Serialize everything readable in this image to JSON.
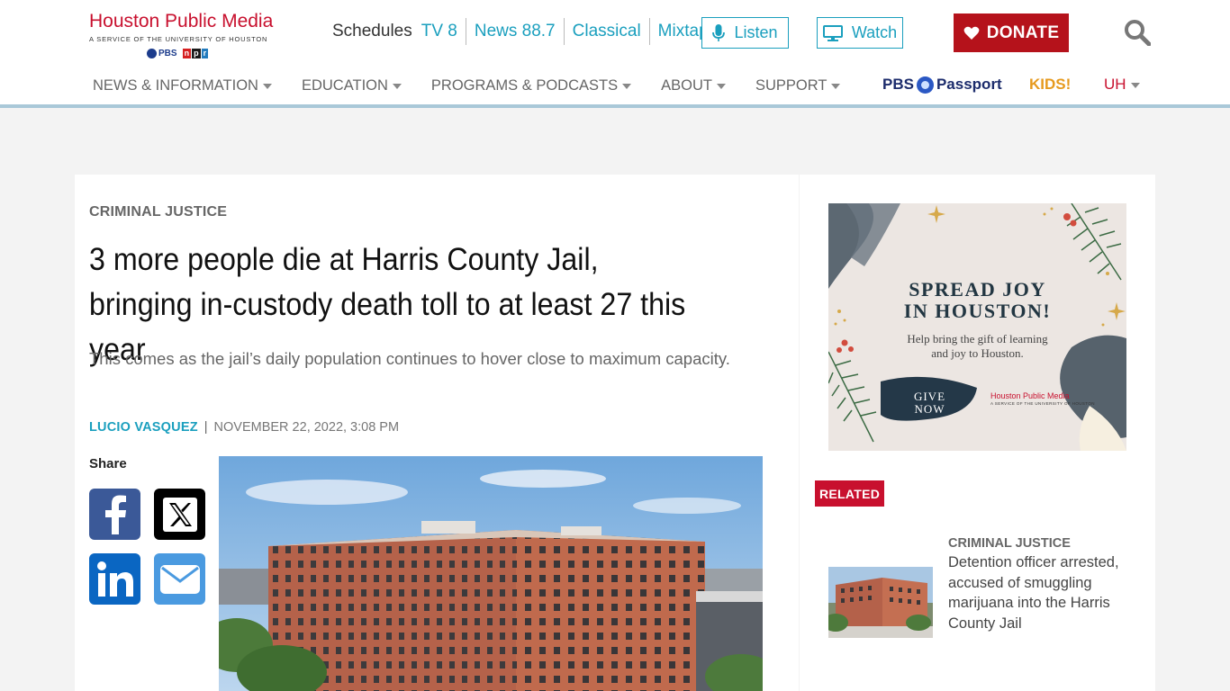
{
  "brand": {
    "title": "Houston Public Media",
    "subtitle": "A SERVICE OF THE UNIVERSITY OF HOUSTON",
    "pbs": "PBS",
    "npr": [
      "n",
      "p",
      "r"
    ],
    "color": "#c8102e"
  },
  "toplinks": {
    "schedules": "Schedules",
    "items": [
      "TV 8",
      "News 88.7",
      "Classical",
      "Mixtape"
    ]
  },
  "actions": {
    "listen": "Listen",
    "watch": "Watch",
    "donate": "DONATE"
  },
  "nav": {
    "items": [
      "NEWS & INFORMATION",
      "EDUCATION",
      "PROGRAMS & PODCASTS",
      "ABOUT",
      "SUPPORT"
    ],
    "passport_pbs": "PBS",
    "passport": "Passport",
    "kids": "KIDS!",
    "uh": "UH"
  },
  "article": {
    "category": "CRIMINAL JUSTICE",
    "headline": "3 more people die at Harris County Jail, bringing in-custody death toll to at least 27 this year",
    "deck": "This comes as the jail’s daily population continues to hover close to maximum capacity.",
    "author": "LUCIO VASQUEZ",
    "separator": "|",
    "date": "NOVEMBER 22, 2022, 3:08 PM",
    "share_label": "Share"
  },
  "ad": {
    "title_line1": "SPREAD JOY",
    "title_line2": "IN HOUSTON!",
    "sub_line1": "Help bring the gift of learning",
    "sub_line2": "and joy to Houston.",
    "give_line1": "GIVE",
    "give_line2": "NOW",
    "logo": "Houston Public Media",
    "logo_sub": "A SERVICE OF THE UNIVERSITY OF HOUSTON"
  },
  "related": {
    "badge": "RELATED",
    "items": [
      {
        "category": "CRIMINAL JUSTICE",
        "title": "Detention officer arrested, accused of smuggling marijuana into the Harris County Jail"
      }
    ]
  },
  "colors": {
    "accent": "#1a9fbe",
    "brand_red": "#c8102e",
    "donate": "#b5121b"
  }
}
